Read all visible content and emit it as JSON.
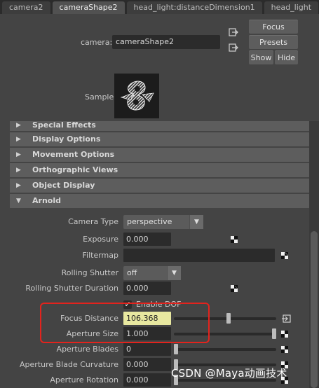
{
  "tabs": [
    "camera2",
    "cameraShape2",
    "head_light:distanceDimension1",
    "head_light"
  ],
  "header": {
    "camera_label": "camera:",
    "camera_value": "cameraShape2",
    "focus_button": "Focus",
    "presets_button": "Presets",
    "show_button": "Show",
    "hide_button": "Hide",
    "sample_label": "Sample"
  },
  "sections": {
    "special_effects": "Special Effects",
    "display_options": "Display Options",
    "movement_options": "Movement Options",
    "orthographic_views": "Orthographic Views",
    "object_display": "Object Display",
    "arnold": "Arnold"
  },
  "arnold": {
    "camera_type_label": "Camera Type",
    "camera_type_value": "perspective",
    "exposure_label": "Exposure",
    "exposure_value": "0.000",
    "filtermap_label": "Filtermap",
    "rolling_shutter_label": "Rolling Shutter",
    "rolling_shutter_value": "off",
    "rolling_shutter_duration_label": "Rolling Shutter Duration",
    "rolling_shutter_duration_value": "0.000",
    "enable_dof_label": "Enable DOF",
    "focus_distance_label": "Focus Distance",
    "focus_distance_value": "106.368",
    "aperture_size_label": "Aperture Size",
    "aperture_size_value": "1.000",
    "aperture_blades_label": "Aperture Blades",
    "aperture_blades_value": "0",
    "aperture_blade_curvature_label": "Aperture Blade Curvature",
    "aperture_blade_curvature_value": "0.000",
    "aperture_rotation_label": "Aperture Rotation",
    "aperture_rotation_value": "0.000"
  },
  "watermark": "CSDN @Maya动画技术",
  "colors": {
    "panel_bg": "#444444",
    "section_bg": "#5d5d5d",
    "field_bg": "#2b2b2b",
    "highlight_field": "#e8e8a0",
    "annotation_red": "#e3231d"
  },
  "icons": [
    "expand-arrow-icon",
    "collapse-arrow-icon",
    "checker-map-icon",
    "input-connection-icon",
    "output-connection-icon",
    "dropdown-arrow-icon",
    "checkmark-icon"
  ]
}
